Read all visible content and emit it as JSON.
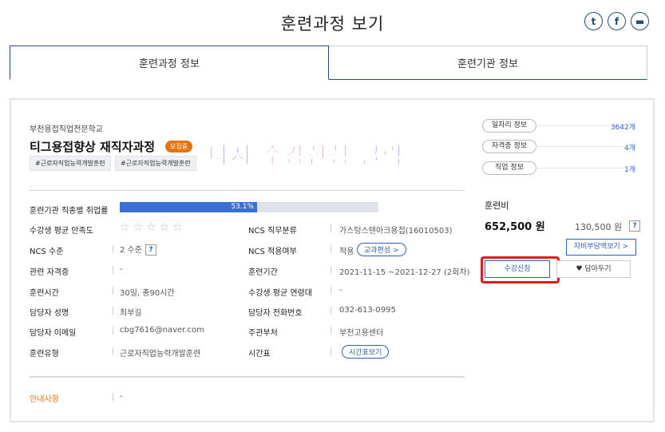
{
  "page": {
    "title": "훈련과정 보기"
  },
  "share": {
    "twitter": "t",
    "facebook": "f",
    "print": "▬"
  },
  "tabs": [
    {
      "label": "훈련과정 정보",
      "active": true
    },
    {
      "label": "훈련기관 정보",
      "active": false
    }
  ],
  "course": {
    "org": "부천용접직업전문학교",
    "title": "티그용접향상 재직자과정",
    "status_badge": "모집중",
    "tags": [
      "#근로자직업능력개발훈련",
      "#근로자직업능력개발훈련"
    ]
  },
  "annotation": {
    "part1": "다시",
    "part2": "수강신청",
    "part3": "클릭"
  },
  "employment": {
    "label": "훈련기관 직종별 취업률",
    "rate_text": "53.1%",
    "rate": 0.531
  },
  "details": {
    "satisfaction_label": "수강생 평균 만족도",
    "satisfaction_stars": "☆☆☆☆☆",
    "ncs_category_label": "NCS 직무분류",
    "ncs_category_value": "가스텅스텐아크용접(16010503)",
    "ncs_level_label": "NCS 수준",
    "ncs_level_value": "2 수준",
    "ncs_apply_label": "NCS 적용여부",
    "ncs_apply_value": "적용",
    "curriculum_button": "교과편성 >",
    "cert_label": "관련 자격증",
    "cert_value": "-",
    "period_label": "훈련기간",
    "period_value": "2021-11-15 ~2021-12-27 (2회차)",
    "hours_label": "훈련시간",
    "hours_value": "30일, 총90시간",
    "age_label": "수강생 평균 연령대",
    "age_value": "-",
    "manager_label": "담당자 성명",
    "manager_value": "최부길",
    "phone_label": "담당자 전화번호",
    "phone_value": "032-613-0995",
    "email_label": "담당자 이메일",
    "email_value": "cbg7616@naver.com",
    "dept_label": "주관부처",
    "dept_value": "부천고용센터",
    "type_label": "훈련유형",
    "type_value": "근로자직업능력개발훈련",
    "timetable_label": "시간표",
    "timetable_button": "시간표보기",
    "notice_label": "안내사항",
    "notice_value": "-"
  },
  "side_info": [
    {
      "label": "일자리 정보",
      "count": "3642개"
    },
    {
      "label": "자격증 정보",
      "count": "4개"
    },
    {
      "label": "직업 정보",
      "count": "1개"
    }
  ],
  "fee": {
    "label": "훈련비",
    "amount": "652,500 원",
    "self_amount": "130,500 원",
    "help": "?",
    "self_button": "자비부담액보기 >",
    "apply_button": "수강신청",
    "save_button": "♥ 담아두기"
  },
  "colors": {
    "accent": "#2f5fb8",
    "bar": "#3b6fd6",
    "badge": "#e8730c",
    "highlight": "#e01b1b"
  }
}
